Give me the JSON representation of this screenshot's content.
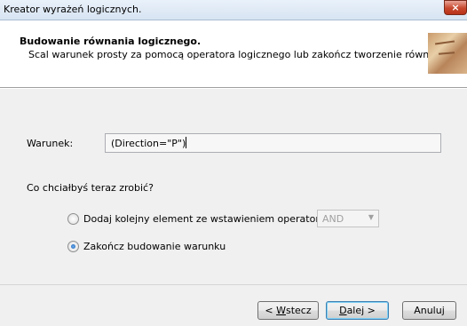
{
  "window": {
    "title": "Kreator wyrażeń logicznych.",
    "close_label": "×"
  },
  "header": {
    "title": "Budowanie równania logicznego.",
    "subtitle": "Scal warunek prosty za pomocą operatora logicznego lub zakończ tworzenie równania."
  },
  "condition": {
    "label": "Warunek:",
    "value": "(Direction=\"P\")"
  },
  "question": "Co chciałbyś teraz zrobić?",
  "options": [
    {
      "label": "Dodaj kolejny element ze wstawieniem operatora",
      "checked": false
    },
    {
      "label": "Zakończ budowanie warunku",
      "checked": true
    }
  ],
  "operator_select": {
    "value": "AND",
    "enabled": false
  },
  "buttons": {
    "back_prefix": "< ",
    "back_mnemonic": "W",
    "back_rest": "stecz",
    "next_mnemonic": "D",
    "next_rest": "alej >",
    "cancel": "Anuluj"
  }
}
